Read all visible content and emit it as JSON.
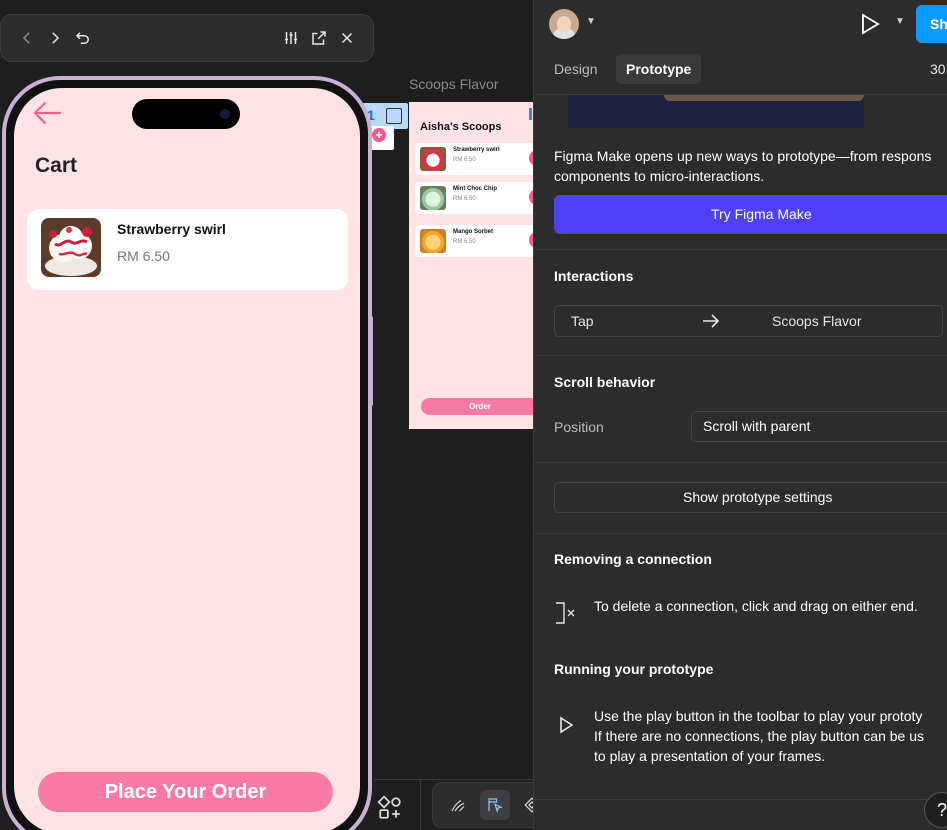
{
  "canvas": {
    "frame_label": "Scoops Flavor",
    "connection_number": "1",
    "plus_symbol": "+",
    "mini_frame": {
      "title": "Aisha's Scoops",
      "items": [
        {
          "name": "Strawberry swirl",
          "price": "RM 6.50"
        },
        {
          "name": "Mint Choc Chip",
          "price": "RM 6.50"
        },
        {
          "name": "Mango Sorbet",
          "price": "RM 6.50"
        }
      ],
      "order_label": "Order"
    },
    "phone": {
      "title": "Cart",
      "item": {
        "name": "Strawberry swirl",
        "price": "RM 6.50"
      },
      "order_button": "Place Your Order"
    }
  },
  "panel": {
    "share_label": "Sh",
    "tabs": {
      "design": "Design",
      "prototype": "Prototype"
    },
    "zoom": "30",
    "banner": {
      "text_line1": "Figma Make opens up new ways to prototype—from respons",
      "text_line2": "components to micro-interactions.",
      "button": "Try Figma Make"
    },
    "interactions": {
      "title": "Interactions",
      "trigger": "Tap",
      "destination": "Scoops Flavor"
    },
    "scroll": {
      "title": "Scroll behavior",
      "position_label": "Position",
      "position_value": "Scroll with parent"
    },
    "settings_button": "Show prototype settings",
    "removing": {
      "title": "Removing a connection",
      "text": "To delete a connection, click and drag on either end."
    },
    "running": {
      "title": "Running your prototype",
      "line1": "Use the play button in the toolbar to play your prototy",
      "line2": "If there are no connections, the play button can be us",
      "line3": "to play a presentation of your frames."
    },
    "help": "?"
  },
  "colors": {
    "accent_blue": "#0d99ff",
    "figma_make_purple": "#4d40f5",
    "pink_button": "#f97ba3",
    "screen_bg": "#ffe3e5"
  }
}
